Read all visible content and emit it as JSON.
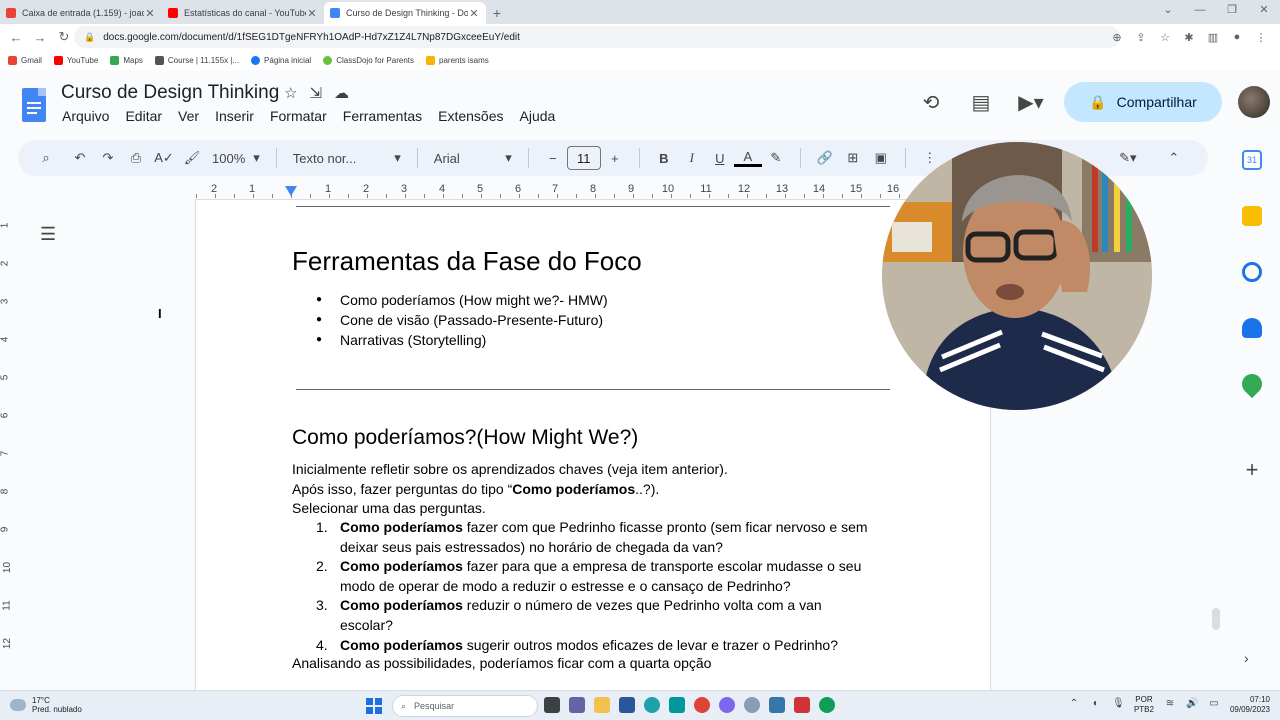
{
  "browser": {
    "tabs": [
      {
        "title": "Caixa de entrada (1.159) - joaoa…",
        "icon": "gmail-icon",
        "color": "#ea4335"
      },
      {
        "title": "Estatísticas do canal - YouTube St…",
        "icon": "youtube-icon",
        "color": "#ff0000"
      },
      {
        "title": "Curso de Design Thinking - Docs",
        "icon": "docs-icon",
        "color": "#4285f4"
      }
    ],
    "url": "docs.google.com/document/d/1fSEG1DTgeNFRYh1OAdP-Hd7xZ1Z4L7Np87DGxceeEuY/edit",
    "bookmarks": [
      {
        "label": "Gmail",
        "color": "#ea4335"
      },
      {
        "label": "YouTube",
        "color": "#ff0000"
      },
      {
        "label": "Maps",
        "color": "#34a853"
      },
      {
        "label": "Course | 11.155x |...",
        "color": "#555555"
      },
      {
        "label": "Página inicial",
        "color": "#1877f2"
      },
      {
        "label": "ClassDojo for Parents",
        "color": "#67c23a"
      },
      {
        "label": "parents isams",
        "color": "#f4b400"
      }
    ]
  },
  "docs": {
    "title": "Curso de Design Thinking",
    "menu": [
      "Arquivo",
      "Editar",
      "Ver",
      "Inserir",
      "Formatar",
      "Ferramentas",
      "Extensões",
      "Ajuda"
    ],
    "share_label": "Compartilhar",
    "toolbar": {
      "zoom": "100%",
      "style": "Texto nor...",
      "font": "Arial",
      "font_size": "11"
    },
    "ruler": [
      "2",
      "1",
      "1",
      "2",
      "3",
      "4",
      "5",
      "6",
      "7",
      "8",
      "9",
      "10",
      "11",
      "12",
      "13",
      "14",
      "15",
      "16"
    ],
    "vruler": [
      "1",
      "2",
      "3",
      "4",
      "5",
      "6",
      "7",
      "8",
      "9",
      "10",
      "11",
      "12"
    ]
  },
  "document": {
    "heading1": "Ferramentas da Fase do Foco",
    "bullets": [
      "Como poderíamos (How might we?- HMW)",
      "Cone de visão (Passado-Presente-Futuro)",
      "Narrativas (Storytelling)"
    ],
    "heading2": "Como poderíamos?(How Might We?)",
    "para1": "Inicialmente refletir sobre os aprendizados chaves (veja item anterior).",
    "para2_prefix": "Após isso, fazer perguntas do tipo “",
    "para2_bold": "Como poderíamos",
    "para2_suffix": "..?).",
    "para3": "Selecionar uma das perguntas.",
    "numbered": [
      {
        "n": "1.",
        "bold": "Como poderíamos",
        "line1": " fazer com que Pedrinho ficasse pronto (sem ficar nervoso e sem",
        "line2": "deixar seus pais estressados) no horário de chegada da van?"
      },
      {
        "n": "2.",
        "bold": "Como poderíamos",
        "line1": " fazer para que a empresa de transporte escolar mudasse o seu",
        "line2": "modo de operar de modo a reduzir o estresse e o cansaço de Pedrinho?"
      },
      {
        "n": "3.",
        "bold": "Como poderíamos",
        "line1": " reduzir o número de vezes que Pedrinho volta com a van",
        "line2": "escolar?"
      },
      {
        "n": "4.",
        "bold": "Como poderíamos",
        "line1": " sugerir outros modos eficazes de levar e trazer o Pedrinho?",
        "line2": ""
      }
    ],
    "para4": "Analisando as possibilidades, poderíamos ficar com a quarta opção"
  },
  "taskbar": {
    "temp": "17°C",
    "weather": "Pred. nublado",
    "search_placeholder": "Pesquisar",
    "lang1": "POR",
    "lang2": "PTB2",
    "time": "07:10",
    "date": "09/09/2023"
  }
}
